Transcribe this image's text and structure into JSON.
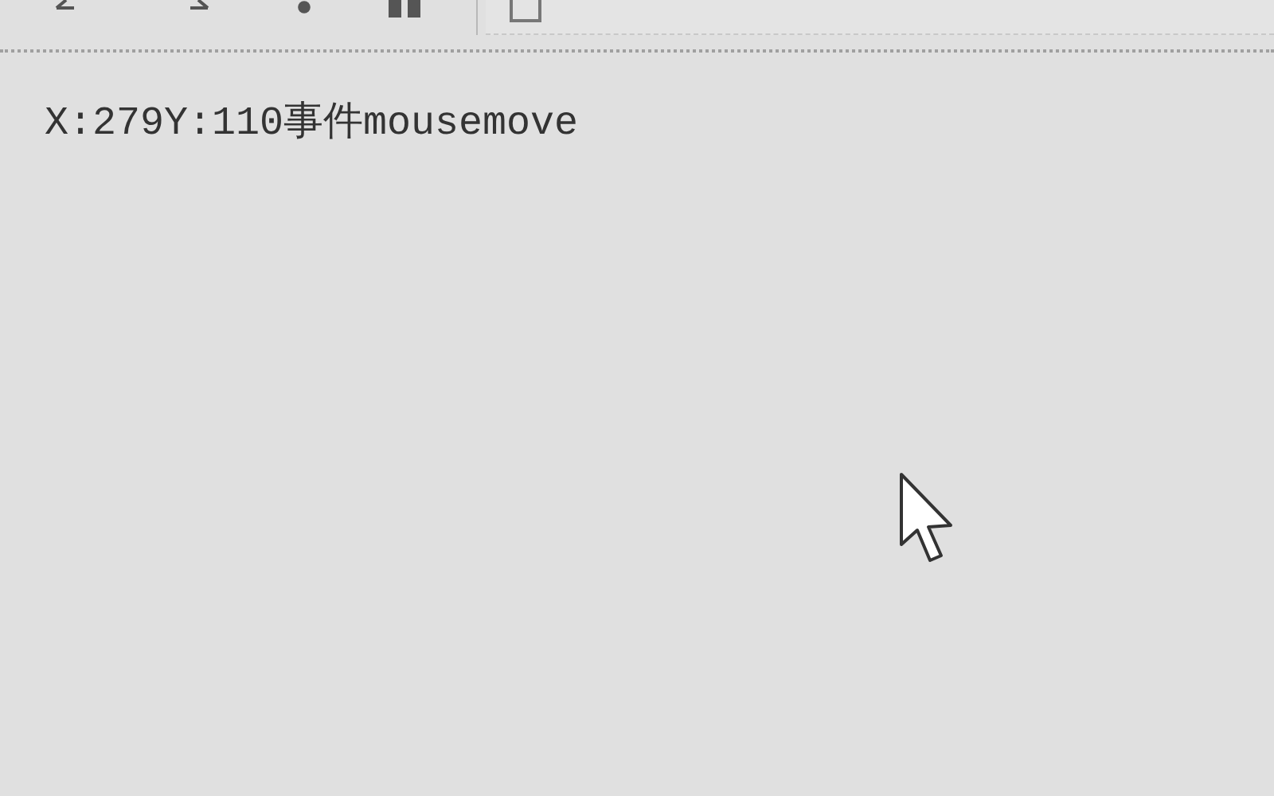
{
  "page": {
    "event_text_parts": [
      "X:279Y:110",
      "事件",
      "mousemove"
    ]
  }
}
